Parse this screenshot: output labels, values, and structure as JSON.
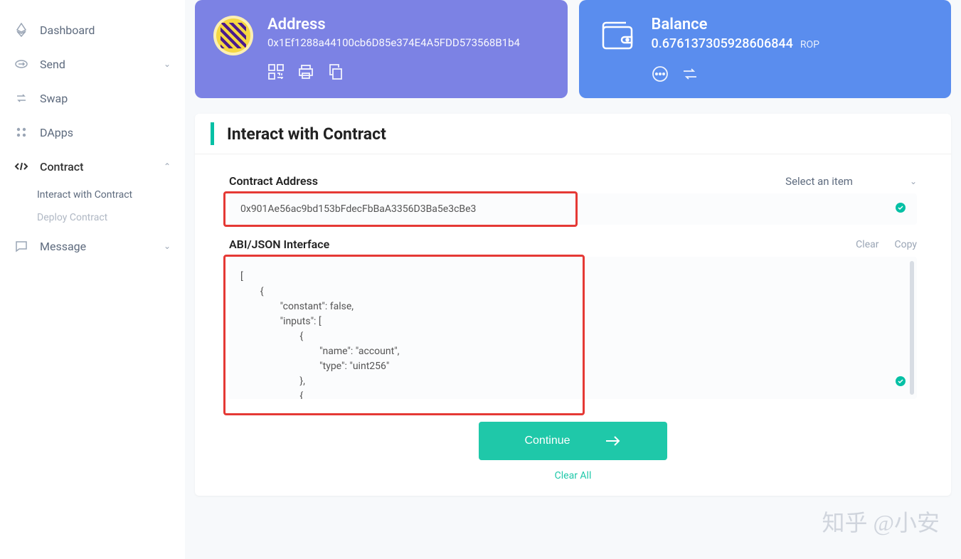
{
  "sidebar": {
    "items": [
      {
        "label": "Dashboard"
      },
      {
        "label": "Send"
      },
      {
        "label": "Swap"
      },
      {
        "label": "DApps"
      },
      {
        "label": "Contract"
      },
      {
        "label": "Message"
      }
    ],
    "contract_sub": [
      {
        "label": "Interact with Contract"
      },
      {
        "label": "Deploy Contract"
      }
    ]
  },
  "cards": {
    "address": {
      "title": "Address",
      "value": "0x1Ef1288a44100cb6D85e374E4A5FDD573568B1b4"
    },
    "balance": {
      "title": "Balance",
      "value": "0.676137305928606844",
      "unit": "ROP"
    }
  },
  "panel": {
    "title": "Interact with Contract",
    "contract_address_label": "Contract Address",
    "select_placeholder": "Select an item",
    "contract_address_value": "0x901Ae56ac9bd153bFdecFbBaA3356D3Ba5e3cBe3",
    "abi_label": "ABI/JSON Interface",
    "clear_label": "Clear",
    "copy_label": "Copy",
    "abi_value": "[\n        {\n                \"constant\": false,\n                \"inputs\": [\n                        {\n                                \"name\": \"account\",\n                                \"type\": \"uint256\"\n                        },\n                        {",
    "continue_label": "Continue",
    "clear_all_label": "Clear All"
  },
  "watermark": "知乎 @小安"
}
